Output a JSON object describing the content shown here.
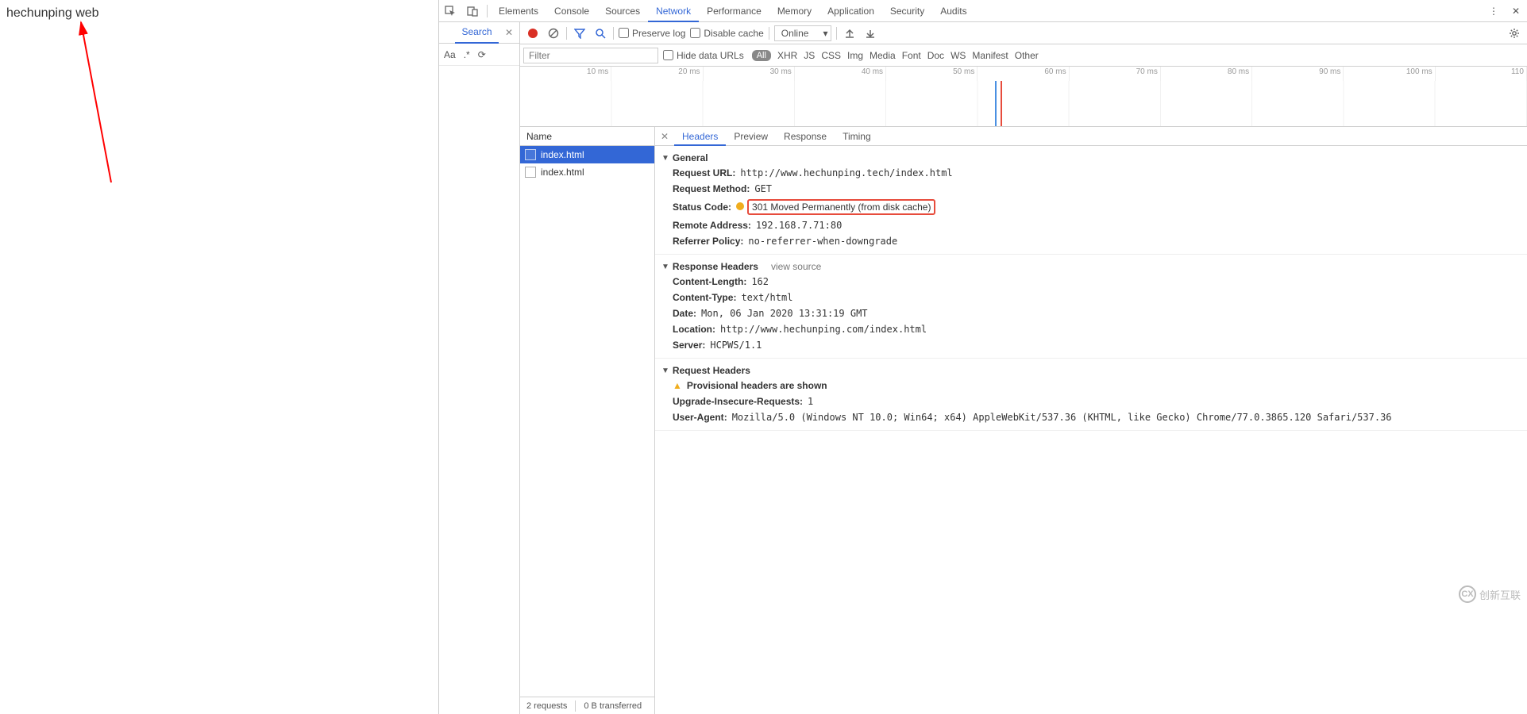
{
  "page": {
    "text": "hechunping web"
  },
  "devtools": {
    "tabs": [
      "Elements",
      "Console",
      "Sources",
      "Network",
      "Performance",
      "Memory",
      "Application",
      "Security",
      "Audits"
    ],
    "active_tab": "Network"
  },
  "search": {
    "label": "Search",
    "opts": {
      "aa": "Aa",
      "regex": ".*",
      "refresh": "⟳"
    }
  },
  "toolbar": {
    "preserve_log": "Preserve log",
    "disable_cache": "Disable cache",
    "throttle": "Online"
  },
  "filter": {
    "placeholder": "Filter",
    "hide_data_urls": "Hide data URLs",
    "types": {
      "all": "All",
      "xhr": "XHR",
      "js": "JS",
      "css": "CSS",
      "img": "Img",
      "media": "Media",
      "font": "Font",
      "doc": "Doc",
      "ws": "WS",
      "manifest": "Manifest",
      "other": "Other"
    }
  },
  "timeline": {
    "ticks": [
      "10 ms",
      "20 ms",
      "30 ms",
      "40 ms",
      "50 ms",
      "60 ms",
      "70 ms",
      "80 ms",
      "90 ms",
      "100 ms",
      "110"
    ]
  },
  "requests": {
    "header": "Name",
    "items": [
      {
        "name": "index.html",
        "selected": true
      },
      {
        "name": "index.html",
        "selected": false
      }
    ]
  },
  "details": {
    "tabs": [
      "Headers",
      "Preview",
      "Response",
      "Timing"
    ],
    "active": "Headers",
    "general": {
      "title": "General",
      "request_url": {
        "k": "Request URL",
        "v": "http://www.hechunping.tech/index.html"
      },
      "request_method": {
        "k": "Request Method",
        "v": "GET"
      },
      "status_code": {
        "k": "Status Code",
        "v": "301 Moved Permanently (from disk cache)"
      },
      "remote_address": {
        "k": "Remote Address",
        "v": "192.168.7.71:80"
      },
      "referrer_policy": {
        "k": "Referrer Policy",
        "v": "no-referrer-when-downgrade"
      }
    },
    "response_headers": {
      "title": "Response Headers",
      "view_source": "view source",
      "content_length": {
        "k": "Content-Length",
        "v": "162"
      },
      "content_type": {
        "k": "Content-Type",
        "v": "text/html"
      },
      "date": {
        "k": "Date",
        "v": "Mon, 06 Jan 2020 13:31:19 GMT"
      },
      "location": {
        "k": "Location",
        "v": "http://www.hechunping.com/index.html"
      },
      "server": {
        "k": "Server",
        "v": "HCPWS/1.1"
      }
    },
    "request_headers": {
      "title": "Request Headers",
      "provisional": "Provisional headers are shown",
      "upgrade": {
        "k": "Upgrade-Insecure-Requests",
        "v": "1"
      },
      "user_agent": {
        "k": "User-Agent",
        "v": "Mozilla/5.0 (Windows NT 10.0; Win64; x64) AppleWebKit/537.36 (KHTML, like Gecko) Chrome/77.0.3865.120 Safari/537.36"
      }
    }
  },
  "status_bar": {
    "requests": "2 requests",
    "transferred": "0 B transferred"
  },
  "watermark": "创新互联"
}
